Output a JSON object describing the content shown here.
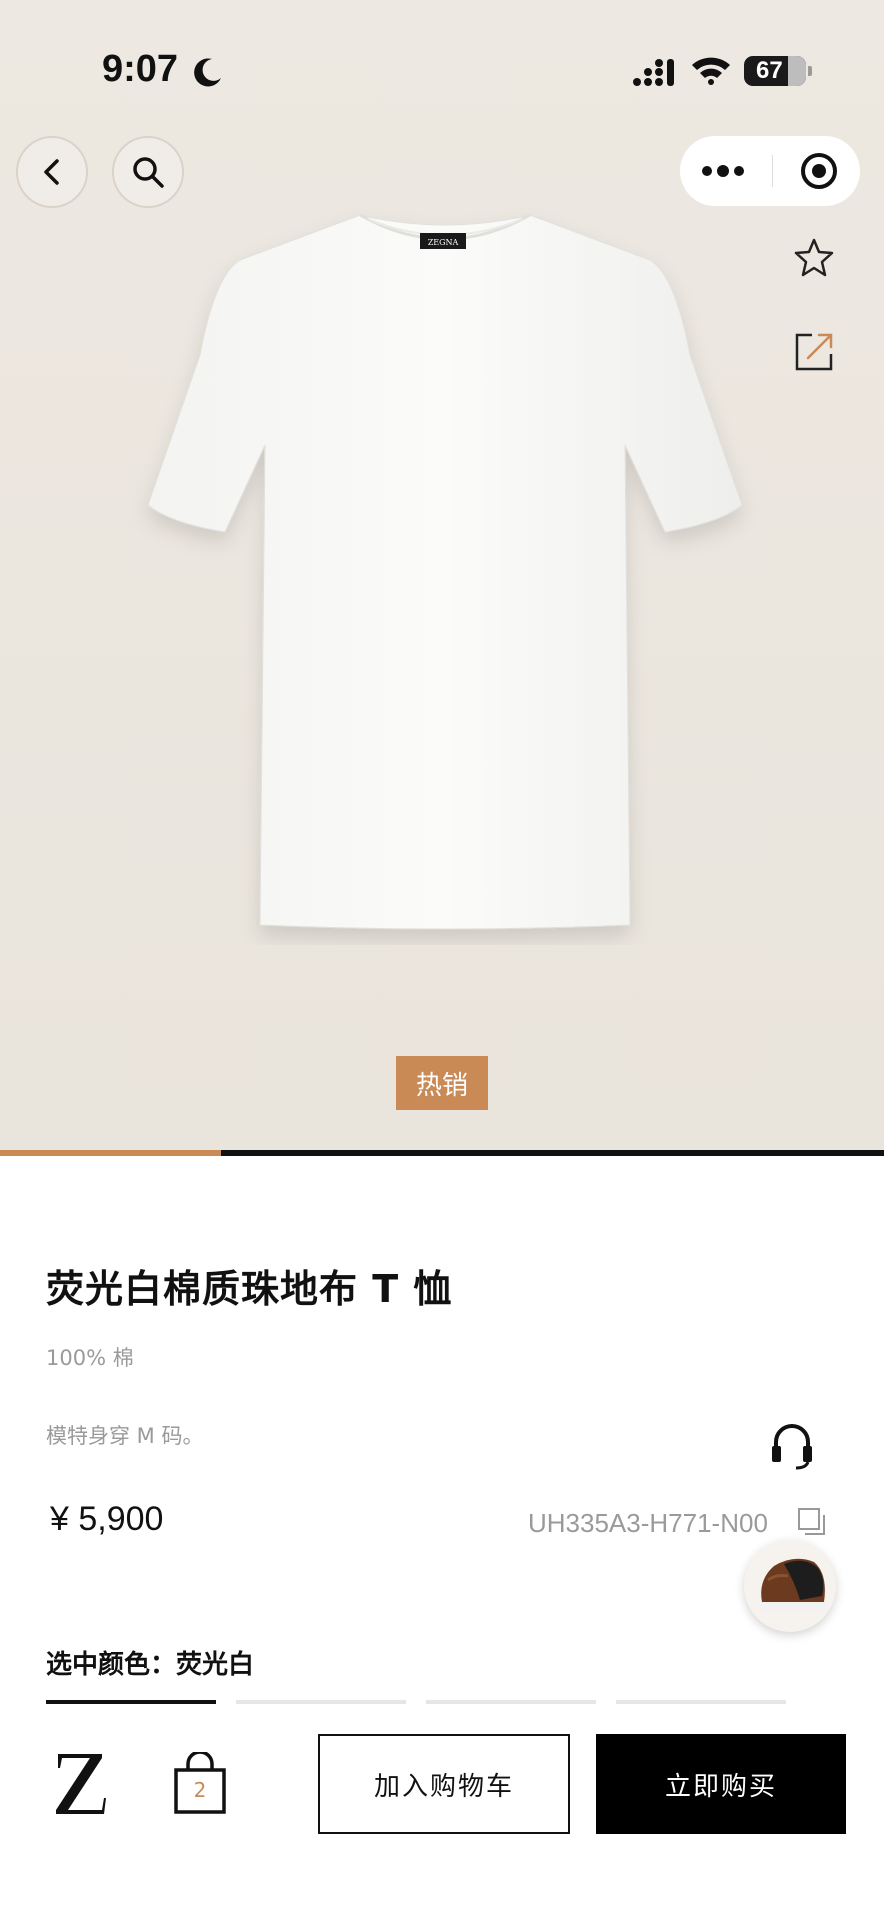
{
  "status_bar": {
    "time": "9:07",
    "battery": "67"
  },
  "nav": {
    "back_icon": "chevron-left-icon",
    "search_icon": "search-icon",
    "more_icon": "more-dots-icon",
    "close_icon": "target-icon"
  },
  "hero": {
    "badge": "热销",
    "image_progress": 0.25,
    "shirt_logo": "ZEGNA"
  },
  "product": {
    "title": "荧光白棉质珠地布 T 恤",
    "material": "100% 棉",
    "model_note": "模特身穿 M 码。",
    "price": "¥ 5,900",
    "sku": "UH335A3-H771-N00",
    "color_label": "选中颜色：荧光白"
  },
  "bottom_bar": {
    "bag_count": "2",
    "add_to_cart": "加入购物车",
    "buy_now": "立即购买"
  },
  "colors": {
    "accent": "#c98a56",
    "dark": "#111111"
  }
}
